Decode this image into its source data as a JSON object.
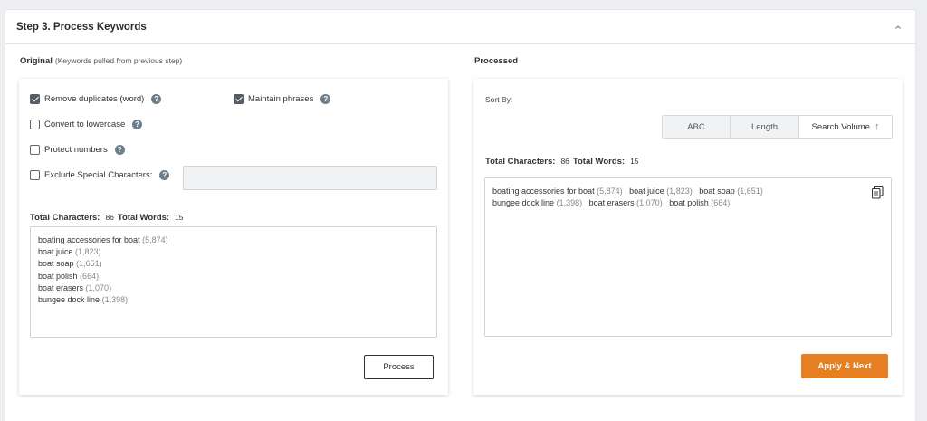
{
  "panel": {
    "title": "Step 3. Process Keywords",
    "collapse_icon": "chevron-up-icon"
  },
  "original": {
    "label": "Original",
    "sublabel": "(Keywords pulled from previous step)",
    "options": {
      "remove_duplicates": {
        "label": "Remove duplicates (word)",
        "checked": true
      },
      "maintain_phrases": {
        "label": "Maintain phrases",
        "checked": true
      },
      "lowercase": {
        "label": "Convert to lowercase",
        "checked": false
      },
      "protect_numbers": {
        "label": "Protect numbers",
        "checked": false
      },
      "exclude_special": {
        "label": "Exclude Special Characters:",
        "checked": false,
        "value": ""
      }
    },
    "help_glyph": "?",
    "stats": {
      "chars_label": "Total Characters:",
      "chars_value": "86",
      "words_label": "Total Words:",
      "words_value": "15"
    },
    "keywords": [
      {
        "text": "boating accessories for boat",
        "volume": "(5,874)"
      },
      {
        "text": "boat juice",
        "volume": "(1,823)"
      },
      {
        "text": "boat soap",
        "volume": "(1,651)"
      },
      {
        "text": "boat polish",
        "volume": "(664)"
      },
      {
        "text": "boat erasers",
        "volume": "(1,070)"
      },
      {
        "text": "bungee dock line",
        "volume": "(1,398)"
      }
    ],
    "process_button": "Process"
  },
  "processed": {
    "label": "Processed",
    "sort_label": "Sort By:",
    "sort_options": [
      "ABC",
      "Length",
      "Search Volume"
    ],
    "sort_active": "Search Volume",
    "sort_arrow": "↑",
    "stats": {
      "chars_label": "Total Characters:",
      "chars_value": "86",
      "words_label": "Total Words:",
      "words_value": "15"
    },
    "keywords": [
      {
        "text": "boating accessories for boat",
        "volume": "(5,874)"
      },
      {
        "text": "boat juice",
        "volume": "(1,823)"
      },
      {
        "text": "boat soap",
        "volume": "(1,651)"
      },
      {
        "text": "bungee dock line",
        "volume": "(1,398)"
      },
      {
        "text": "boat erasers",
        "volume": "(1,070)"
      },
      {
        "text": "boat polish",
        "volume": "(664)"
      }
    ],
    "copy_icon": "copy-icon",
    "apply_button": "Apply & Next",
    "apply_color": "#e67e22"
  }
}
